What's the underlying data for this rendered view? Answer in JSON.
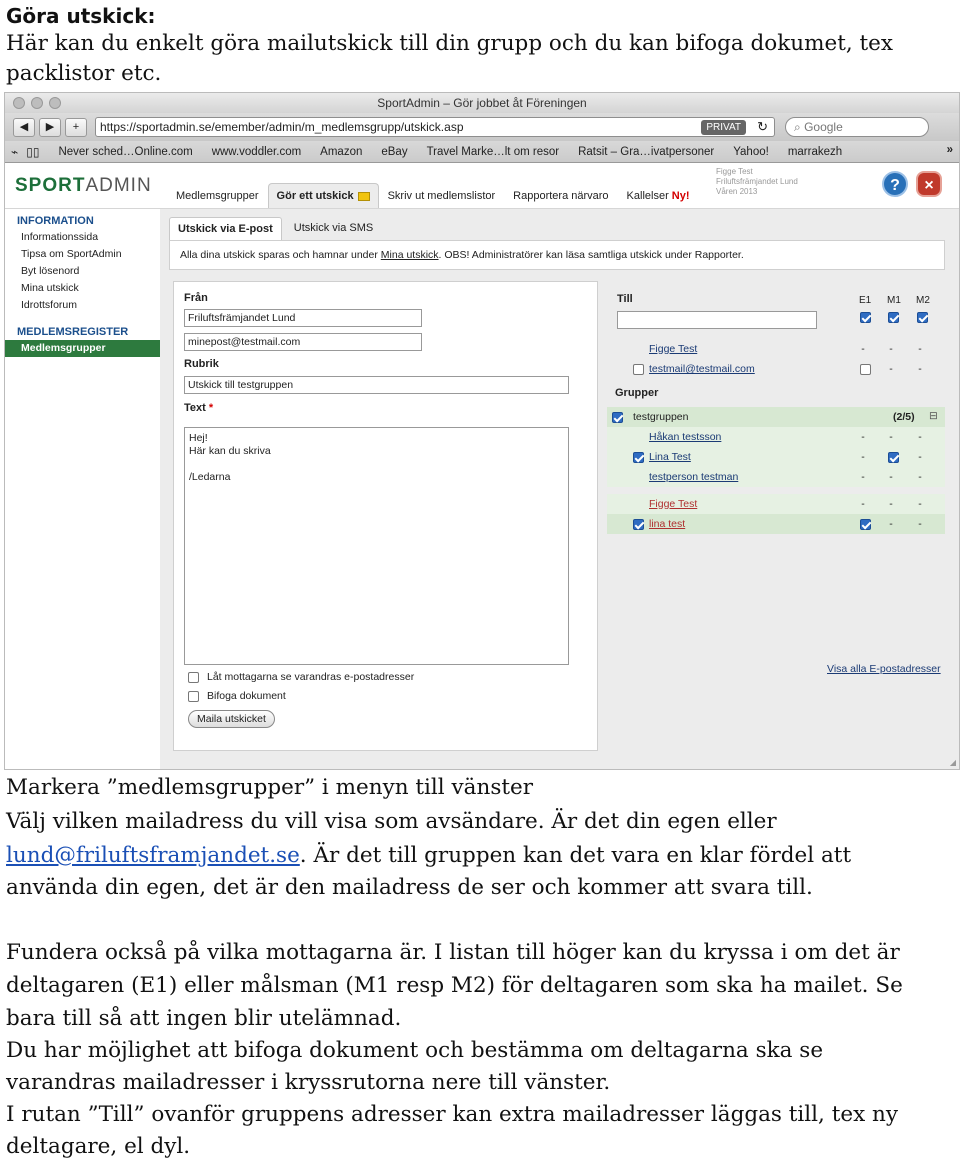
{
  "doc": {
    "heading": "Göra utskick:",
    "intro_1": "Här kan du enkelt göra mailutskick till din grupp och du kan bifoga dokumet, tex",
    "intro_2": "packlistor etc.",
    "p1_l1": "Markera ”medlemsgrupper” i menyn till vänster",
    "p1_l2": "Välj vilken mailadress du vill visa som avsändare. Är det din egen eller",
    "p1_link": "lund@friluftsframjandet.se",
    "p1_l3_rest": ". Är det till gruppen kan det vara en klar fördel att",
    "p1_l4": "använda din egen, det är den mailadress de ser och kommer att svara till.",
    "p2_l1": "Fundera också på vilka mottagarna är. I listan till höger kan du kryssa i om det är",
    "p2_l2": "deltagaren (E1) eller målsman (M1 resp M2) för deltagaren som ska ha mailet. Se",
    "p2_l3": "bara till så att ingen blir utelämnad.",
    "p3_l1": "Du har möjlighet att bifoga dokument och bestämma om deltagarna ska se",
    "p3_l2": "varandras mailadresser i kryssrutorna nere till vänster.",
    "p4_l1": "I rutan ”Till” ovanför gruppens adresser kan extra mailadresser läggas till, tex ny",
    "p4_l2": "deltagare, el dyl."
  },
  "browser": {
    "title": "SportAdmin – Gör jobbet åt Föreningen",
    "url": "https://sportadmin.se/emember/admin/m_medlemsgrupp/utskick.asp",
    "privat": "PRIVAT",
    "search_placeholder": "Google",
    "bookmarks": [
      "Never sched…Online.com",
      "www.voddler.com",
      "Amazon",
      "eBay",
      "Travel Marke…lt om resor",
      "Ratsit – Gra…ivatpersoner",
      "Yahoo!",
      "marrakezh"
    ]
  },
  "app": {
    "logo_a": "SPORT",
    "logo_b": "ADMIN",
    "tabs": [
      "Medlemsgrupper",
      "Gör ett utskick",
      "Skriv ut medlemslistor",
      "Rapportera närvaro",
      "Kallelser"
    ],
    "tab_new": "Ny!",
    "user_line1": "Figge Test",
    "user_line2": "Friluftsfrämjandet Lund",
    "user_line3": "Våren 2013",
    "help": "?",
    "close": "×"
  },
  "sidebar": {
    "header1": "INFORMATION",
    "items": [
      "Informationssida",
      "Tipsa om SportAdmin",
      "Byt lösenord",
      "Mina utskick",
      "Idrottsforum"
    ],
    "header2": "MEDLEMSREGISTER",
    "selected": "Medlemsgrupper"
  },
  "subtabs": [
    "Utskick via E-post",
    "Utskick via SMS"
  ],
  "notice": {
    "pre": "Alla dina utskick sparas och hamnar under ",
    "link": "Mina utskick",
    "post": ". OBS! Administratörer kan läsa samtliga utskick under Rapporter."
  },
  "form": {
    "from_label": "Från",
    "from_value": "Friluftsfrämjandet Lund",
    "from_email": "minepost@testmail.com",
    "subject_label": "Rubrik",
    "subject_value": "Utskick till testgruppen",
    "text_label": "Text",
    "text_req": "*",
    "text_lines": [
      "Hej!",
      "Här kan du skriva",
      "",
      "/Ledarna"
    ],
    "check_show": "Låt mottagarna se varandras e-postadresser",
    "check_attach": "Bifoga dokument",
    "send_button": "Maila utskicket"
  },
  "recipients": {
    "till_label": "Till",
    "col_e1": "E1",
    "col_m1": "M1",
    "col_m2": "M2",
    "groups_label": "Grupper",
    "group_name": "testgruppen",
    "group_count": "(2/5)",
    "collapse_icon": "⊟",
    "dash": "-",
    "extra": [
      {
        "name": "Figge Test"
      },
      {
        "name": "testmail@testmail.com"
      }
    ],
    "members": [
      {
        "name": "Håkan testsson"
      },
      {
        "name": "Lina Test"
      },
      {
        "name": "testperson testman"
      },
      {
        "name": "Figge Test"
      },
      {
        "name": "lina test"
      }
    ],
    "view_all": "Visa alla E-postadresser"
  },
  "colors": {
    "brand_green": "#2d7a3e",
    "link_blue": "#1a4fb5",
    "checkbox_blue": "#2f6cc2"
  }
}
